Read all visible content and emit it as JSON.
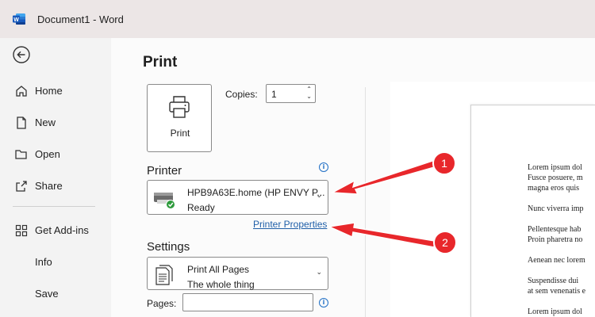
{
  "window": {
    "title": "Document1  -  Word",
    "app_icon": "word-icon"
  },
  "sidebar": {
    "back_icon": "back-arrow-icon",
    "items": [
      {
        "label": "Home",
        "icon": "home-icon"
      },
      {
        "label": "New",
        "icon": "new-document-icon"
      },
      {
        "label": "Open",
        "icon": "folder-icon"
      },
      {
        "label": "Share",
        "icon": "share-icon"
      },
      {
        "label": "Get Add-ins",
        "icon": "grid-icon"
      },
      {
        "label": "Info",
        "icon": ""
      },
      {
        "label": "Save",
        "icon": ""
      }
    ]
  },
  "print": {
    "title": "Print",
    "print_button_label": "Print",
    "copies_label": "Copies:",
    "copies_value": "1"
  },
  "printer": {
    "heading": "Printer",
    "name": "HPB9A63E.home (HP ENVY P...",
    "status": "Ready",
    "properties_link": "Printer Properties"
  },
  "settings": {
    "heading": "Settings",
    "pages_option_title": "Print All Pages",
    "pages_option_desc": "The whole thing",
    "pages_label": "Pages:",
    "pages_value": ""
  },
  "callouts": [
    "1",
    "2"
  ],
  "colors": {
    "callout_red": "#e8272b",
    "link_blue": "#1f5fa8",
    "word_blue": "#2b579a"
  },
  "preview": {
    "lines": [
      "Lorem ipsum dol",
      "Fusce posuere, m",
      "magna eros quis",
      "Nunc viverra imp",
      "Pellentesque hab",
      "Proin pharetra no",
      "Aenean nec lorem",
      "Suspendisse dui",
      "at sem venenatis e",
      "Lorem ipsum dol"
    ]
  }
}
